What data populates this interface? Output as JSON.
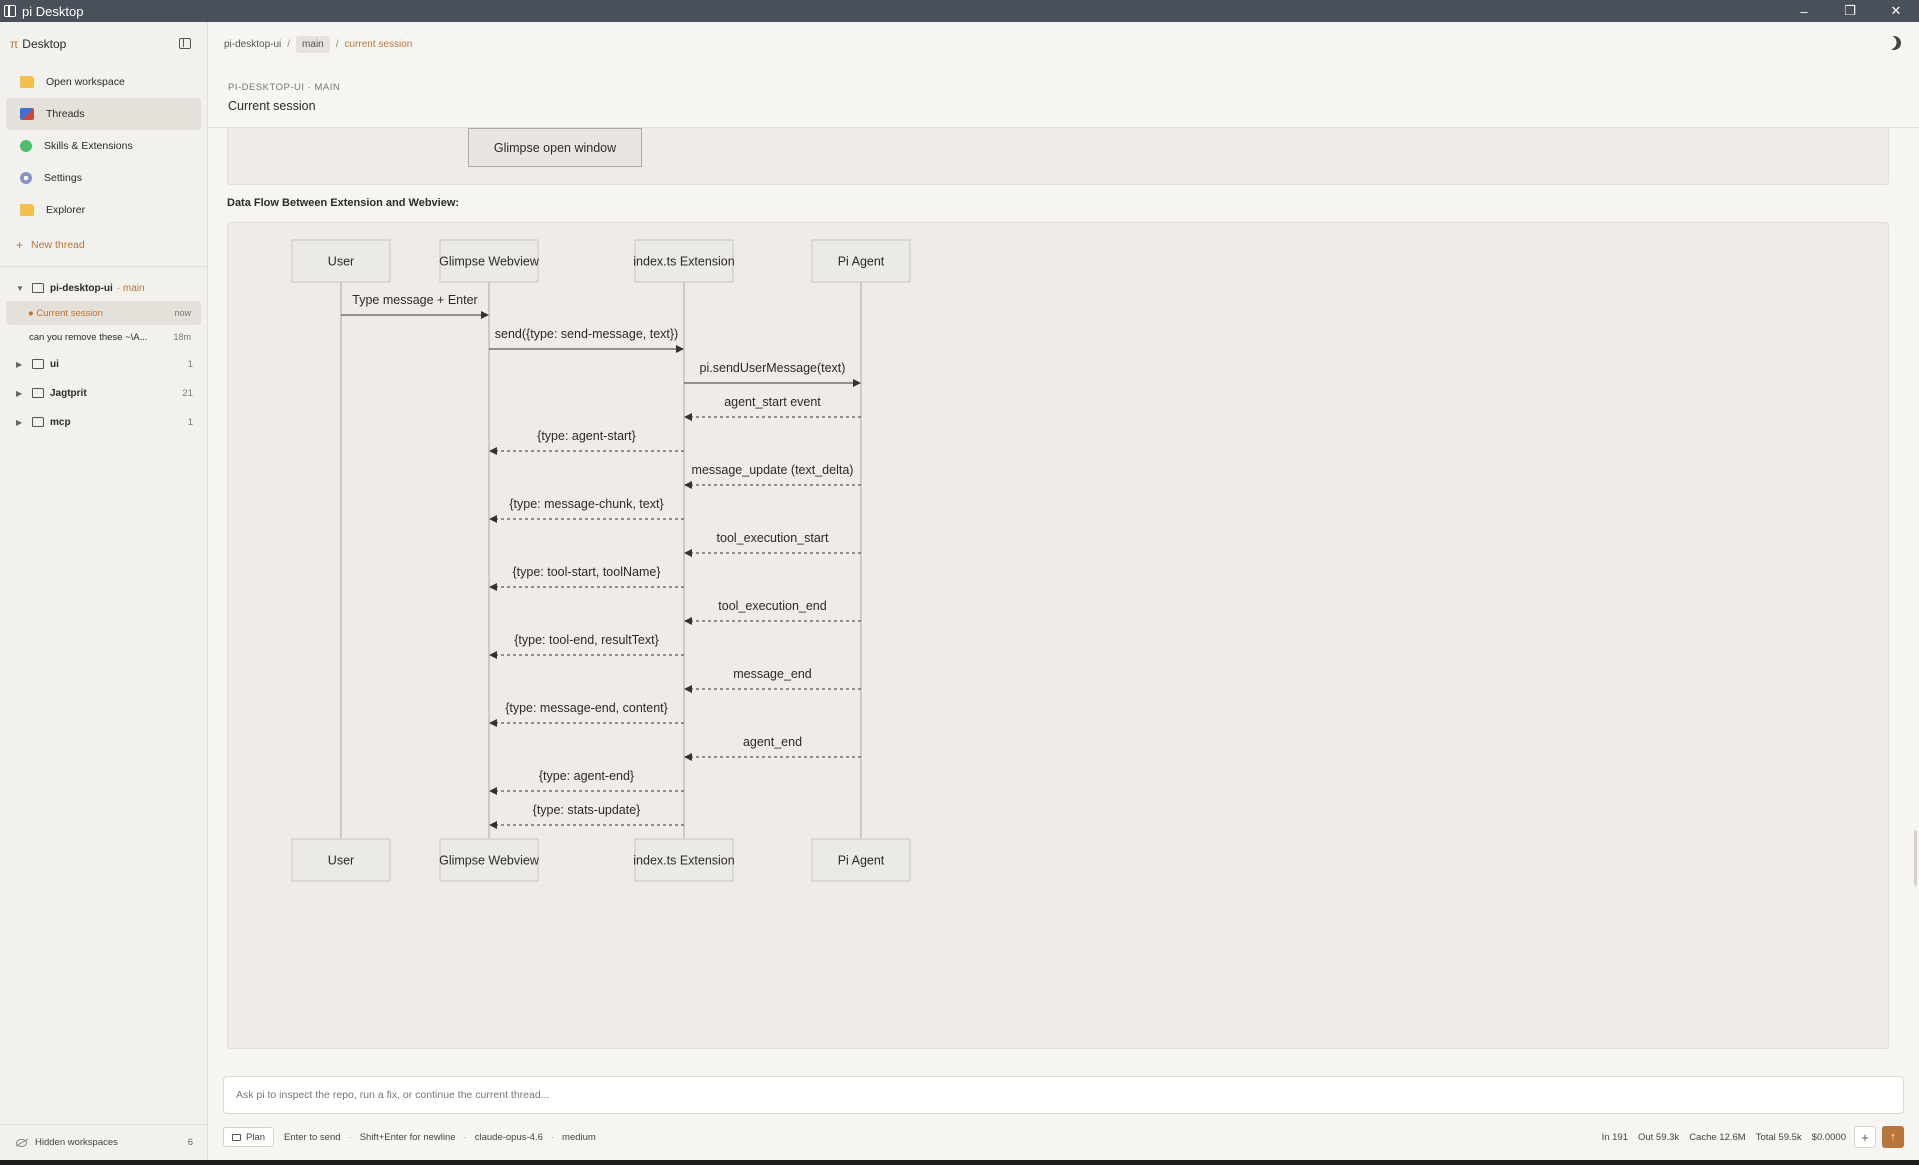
{
  "window": {
    "title": "pi Desktop",
    "controls": [
      "–",
      "❐",
      "✕"
    ]
  },
  "sidebar": {
    "brand_symbol": "π",
    "brand": "Desktop",
    "nav": [
      {
        "label": "Open workspace",
        "icon": "folder-icon"
      },
      {
        "label": "Threads",
        "icon": "threads-icon"
      },
      {
        "label": "Skills & Extensions",
        "icon": "puzzle-icon"
      },
      {
        "label": "Settings",
        "icon": "gear-icon"
      },
      {
        "label": "Explorer",
        "icon": "folder-icon"
      }
    ],
    "new_thread": "New thread",
    "workspaces": [
      {
        "name": "pi-desktop-ui",
        "branch": "· main",
        "expanded": true,
        "threads": [
          {
            "label": "● Current session",
            "time": "now"
          },
          {
            "label": "can you remove these ~\\A...",
            "time": "18m"
          }
        ]
      },
      {
        "name": "ui",
        "count": "1"
      },
      {
        "name": "Jagtprit",
        "count": "21"
      },
      {
        "name": "mcp",
        "count": "1"
      }
    ],
    "footer": {
      "label": "Hidden workspaces",
      "count": "6"
    }
  },
  "breadcrumb": {
    "repo": "pi-desktop-ui",
    "branch": "main",
    "current": "current session"
  },
  "session": {
    "eyebrow": "PI-DESKTOP-UI · MAIN",
    "title": "Current session"
  },
  "content": {
    "glimpse_button": "Glimpse open window",
    "section_title": "Data Flow Between Extension and Webview:"
  },
  "diagram": {
    "actors": [
      "User",
      "Glimpse Webview",
      "index.ts Extension",
      "Pi Agent"
    ],
    "messages": [
      {
        "from": 0,
        "to": 1,
        "label": "Type message + Enter",
        "style": "solid"
      },
      {
        "from": 1,
        "to": 2,
        "label": "send({type: send-message, text})",
        "style": "solid"
      },
      {
        "from": 2,
        "to": 3,
        "label": "pi.sendUserMessage(text)",
        "style": "solid"
      },
      {
        "from": 3,
        "to": 2,
        "label": "agent_start event",
        "style": "dashed"
      },
      {
        "from": 2,
        "to": 1,
        "label": "{type: agent-start}",
        "style": "dashed"
      },
      {
        "from": 3,
        "to": 2,
        "label": "message_update (text_delta)",
        "style": "dashed"
      },
      {
        "from": 2,
        "to": 1,
        "label": "{type: message-chunk, text}",
        "style": "dashed"
      },
      {
        "from": 3,
        "to": 2,
        "label": "tool_execution_start",
        "style": "dashed"
      },
      {
        "from": 2,
        "to": 1,
        "label": "{type: tool-start, toolName}",
        "style": "dashed"
      },
      {
        "from": 3,
        "to": 2,
        "label": "tool_execution_end",
        "style": "dashed"
      },
      {
        "from": 2,
        "to": 1,
        "label": "{type: tool-end, resultText}",
        "style": "dashed"
      },
      {
        "from": 3,
        "to": 2,
        "label": "message_end",
        "style": "dashed"
      },
      {
        "from": 2,
        "to": 1,
        "label": "{type: message-end, content}",
        "style": "dashed"
      },
      {
        "from": 3,
        "to": 2,
        "label": "agent_end",
        "style": "dashed"
      },
      {
        "from": 2,
        "to": 1,
        "label": "{type: agent-end}",
        "style": "dashed"
      },
      {
        "from": 2,
        "to": 1,
        "label": "{type: stats-update}",
        "style": "dashed"
      }
    ]
  },
  "composer": {
    "placeholder": "Ask pi to inspect the repo, run a fix, or continue the current thread...",
    "plan_label": "Plan",
    "hints": [
      "Enter to send",
      "Shift+Enter for newline",
      "claude-opus-4.6",
      "medium"
    ],
    "stats": [
      "In 191",
      "Out 59.3k",
      "Cache 12.6M",
      "Total 59.5k",
      "$0.0000"
    ],
    "add_symbol": "+",
    "send_symbol": "↑"
  },
  "colors": {
    "accent": "#b8763a",
    "titlebar": "#49505a",
    "sidebar_bg": "#f3f1ee",
    "panel_bg": "#efece7"
  }
}
